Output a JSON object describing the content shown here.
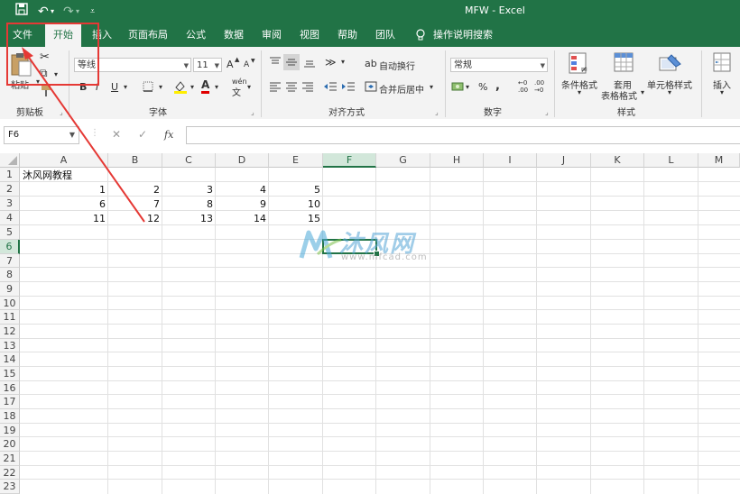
{
  "title": "MFW  -  Excel",
  "quick_access": {
    "save_icon": "save-icon",
    "undo_icon": "undo-icon",
    "redo_icon": "redo-icon",
    "customize_icon": "customize-qat-icon"
  },
  "tabs": [
    "文件",
    "开始",
    "插入",
    "页面布局",
    "公式",
    "数据",
    "审阅",
    "视图",
    "帮助",
    "团队",
    "操作说明搜索"
  ],
  "ribbon": {
    "clipboard": {
      "paste": "粘贴",
      "group": "剪贴板"
    },
    "font": {
      "name": "等线",
      "size": "11",
      "grow": "A",
      "shrink": "A",
      "bold": "B",
      "italic": "I",
      "underline": "U",
      "fill_letter": "A",
      "color_letter": "A",
      "wen": "wén",
      "group": "字体"
    },
    "alignment": {
      "wrap": "自动换行",
      "merge": "合并后居中",
      "group": "对齐方式"
    },
    "number": {
      "format": "常规",
      "percent": "%",
      "comma": ",",
      "group": "数字"
    },
    "styles": {
      "conditional": "条件格式",
      "table_fmt_1": "套用",
      "table_fmt_2": "表格格式",
      "cell_styles": "单元格样式",
      "group": "样式"
    },
    "cells": {
      "insert": "插入"
    }
  },
  "formula_bar": {
    "name_box": "F6",
    "cancel": "✕",
    "enter": "✓",
    "fx": "fx",
    "value": ""
  },
  "columns": [
    "A",
    "B",
    "C",
    "D",
    "E",
    "F",
    "G",
    "H",
    "I",
    "J",
    "K",
    "L",
    "M"
  ],
  "selected_column": "F",
  "rows": [
    "1",
    "2",
    "3",
    "4",
    "5",
    "6",
    "7",
    "8",
    "9",
    "10",
    "11",
    "12",
    "13",
    "14",
    "15",
    "16",
    "17",
    "18",
    "19",
    "20",
    "21",
    "22",
    "23"
  ],
  "selected_row": "6",
  "cells": {
    "A1": "沐风网教程",
    "row2": [
      "1",
      "2",
      "3",
      "4",
      "5"
    ],
    "row3": [
      "6",
      "7",
      "8",
      "9",
      "10"
    ],
    "row4": [
      "11",
      "12",
      "13",
      "14",
      "15"
    ]
  },
  "watermark": {
    "brand": "沐风网",
    "url": "www.mfcad.com"
  },
  "colors": {
    "excel_green": "#217346",
    "annotation_red": "#e53935"
  }
}
